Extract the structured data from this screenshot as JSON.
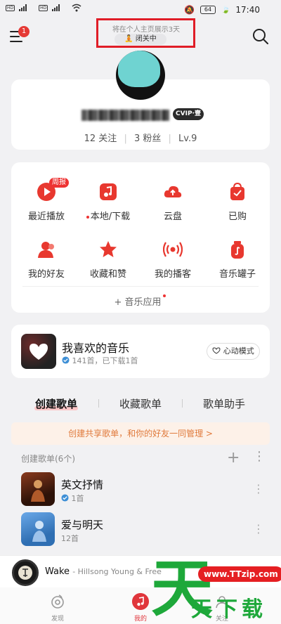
{
  "status_bar": {
    "left_badges": [
      "HD",
      "HD"
    ],
    "battery": "64",
    "time": "17:40"
  },
  "header": {
    "notif_count": "1",
    "hint": "将在个人主页展示3天",
    "status": "闭关中",
    "status_emoji": "🧘"
  },
  "profile": {
    "vip": "CVIP·壹",
    "follow": "12 关注",
    "fans": "3 粉丝",
    "level": "Lv.9"
  },
  "grid": {
    "weekly_tag": "周报",
    "items": [
      {
        "label": "最近播放",
        "color": "#e8382f"
      },
      {
        "label": "本地/下载",
        "color": "#e8382f"
      },
      {
        "label": "云盘",
        "color": "#e8382f"
      },
      {
        "label": "已购",
        "color": "#e8382f"
      },
      {
        "label": "我的好友",
        "color": "#e8382f"
      },
      {
        "label": "收藏和赞",
        "color": "#e8382f"
      },
      {
        "label": "我的播客",
        "color": "#e8382f"
      },
      {
        "label": "音乐罐子",
        "color": "#e8382f"
      }
    ],
    "music_apps": "+ 音乐应用"
  },
  "liked": {
    "title": "我喜欢的音乐",
    "sub": "141首，已下载1首",
    "mode": "心动模式"
  },
  "tabs": [
    "创建歌单",
    "收藏歌单",
    "歌单助手"
  ],
  "share_banner": "创建共享歌单，和你的好友一同管理 >",
  "playlists": {
    "header": "创建歌单(6个)",
    "items": [
      {
        "title": "英文抒情",
        "sub": "1首"
      },
      {
        "title": "爱与明天",
        "sub": "12首"
      }
    ]
  },
  "player": {
    "title": "Wake",
    "artist": "- Hillsong Young & Free"
  },
  "nav": {
    "items": [
      "发现",
      "我的",
      "关注"
    ]
  },
  "watermark": {
    "big": "天",
    "url": "www.TTzip.com",
    "small": "天下载"
  }
}
